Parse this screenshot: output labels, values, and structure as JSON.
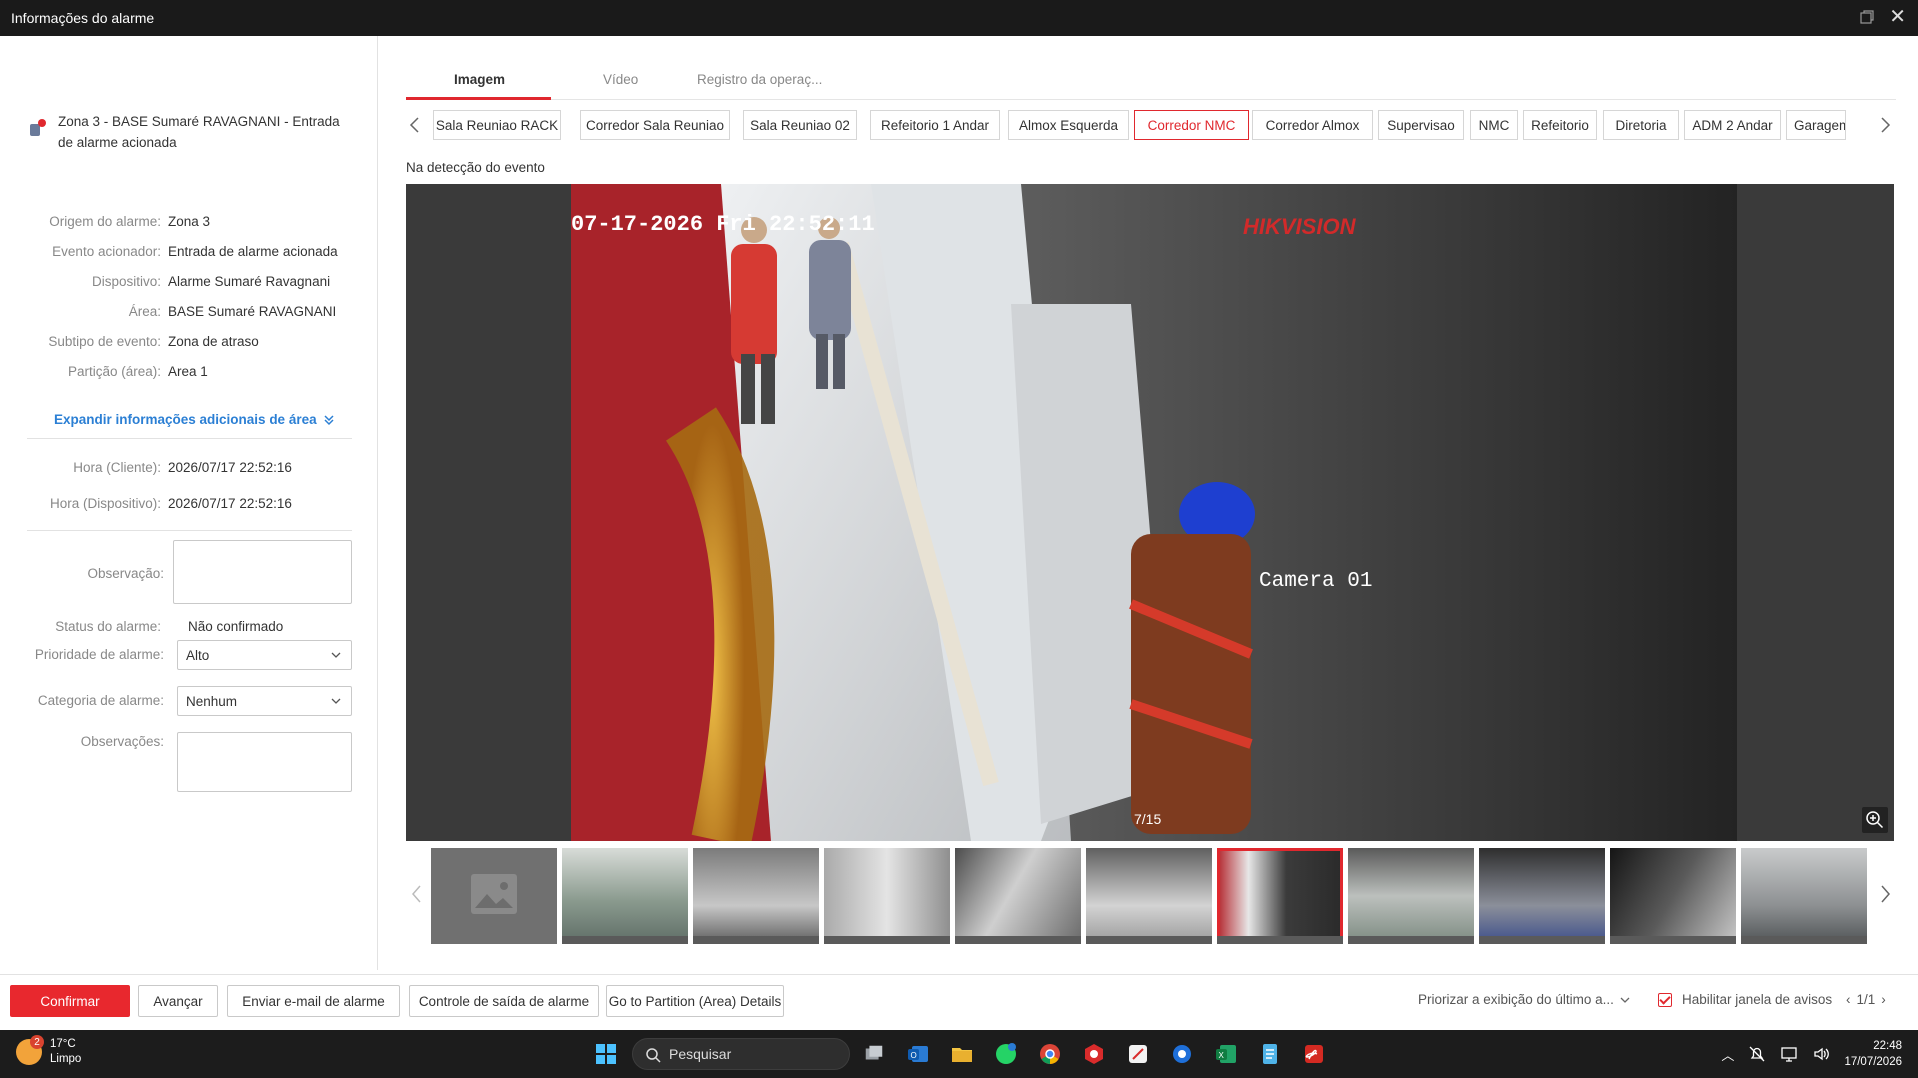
{
  "window": {
    "title": "Informações do alarme"
  },
  "alarm": {
    "header": "Zona 3 - BASE Sumaré RAVAGNANI - Entrada de alarme acionada",
    "details": [
      {
        "label": "Origem do alarme:",
        "value": "Zona 3"
      },
      {
        "label": "Evento acionador:",
        "value": "Entrada de alarme acionada"
      },
      {
        "label": "Dispositivo:",
        "value": "Alarme Sumaré Ravagnani"
      },
      {
        "label": "Área:",
        "value": "BASE Sumaré RAVAGNANI"
      },
      {
        "label": "Subtipo de evento:",
        "value": "Zona de atraso"
      },
      {
        "label": "Partição (área):",
        "value": "Area 1"
      }
    ],
    "expand_label": "Expandir informações adicionais de área",
    "times": [
      {
        "label": "Hora (Cliente):",
        "value": "2026/07/17 22:52:16"
      },
      {
        "label": "Hora (Dispositivo):",
        "value": "2026/07/17 22:52:16"
      }
    ],
    "observation_label": "Observação:",
    "status_label": "Status do alarme:",
    "status_value": "Não confirmado",
    "priority_label": "Prioridade de alarme:",
    "priority_value": "Alto",
    "category_label": "Categoria de alarme:",
    "category_value": "Nenhum",
    "notes_label": "Observações:"
  },
  "tabs": [
    "Imagem",
    "Vídeo",
    "Registro da operaç..."
  ],
  "cameras": [
    "Sala Reuniao RACK",
    "Corredor Sala Reuniao",
    "Sala Reuniao 02",
    "Refeitorio 1 Andar",
    "Almox Esquerda",
    "Corredor NMC",
    "Corredor Almox",
    "Supervisao",
    "NMC",
    "Refeitorio",
    "Diretoria",
    "ADM 2 Andar",
    "Garagem"
  ],
  "active_camera": "Corredor NMC",
  "detection_label": "Na detecção do evento",
  "viewer": {
    "osd_timestamp": "07-17-2026 Fri 22:52:11",
    "brand": "HIKVISION",
    "camera_name": "Camera 01",
    "counter": "7/15"
  },
  "footer": {
    "confirm": "Confirmar",
    "next": "Avançar",
    "email": "Enviar e-mail de alarme",
    "output": "Controle de saída de alarme",
    "partition": "Go to Partition (Area) Details",
    "prioritize": "Priorizar a exibição do último a...",
    "enable_popup": "Habilitar janela de avisos",
    "pager": "1/1"
  },
  "taskbar": {
    "weather_temp": "17°C",
    "weather_desc": "Limpo",
    "weather_badge": "2",
    "search_placeholder": "Pesquisar",
    "time": "22:48",
    "date": "17/07/2026"
  },
  "colors": {
    "accent": "#e0282e",
    "link": "#2b7fd4"
  }
}
